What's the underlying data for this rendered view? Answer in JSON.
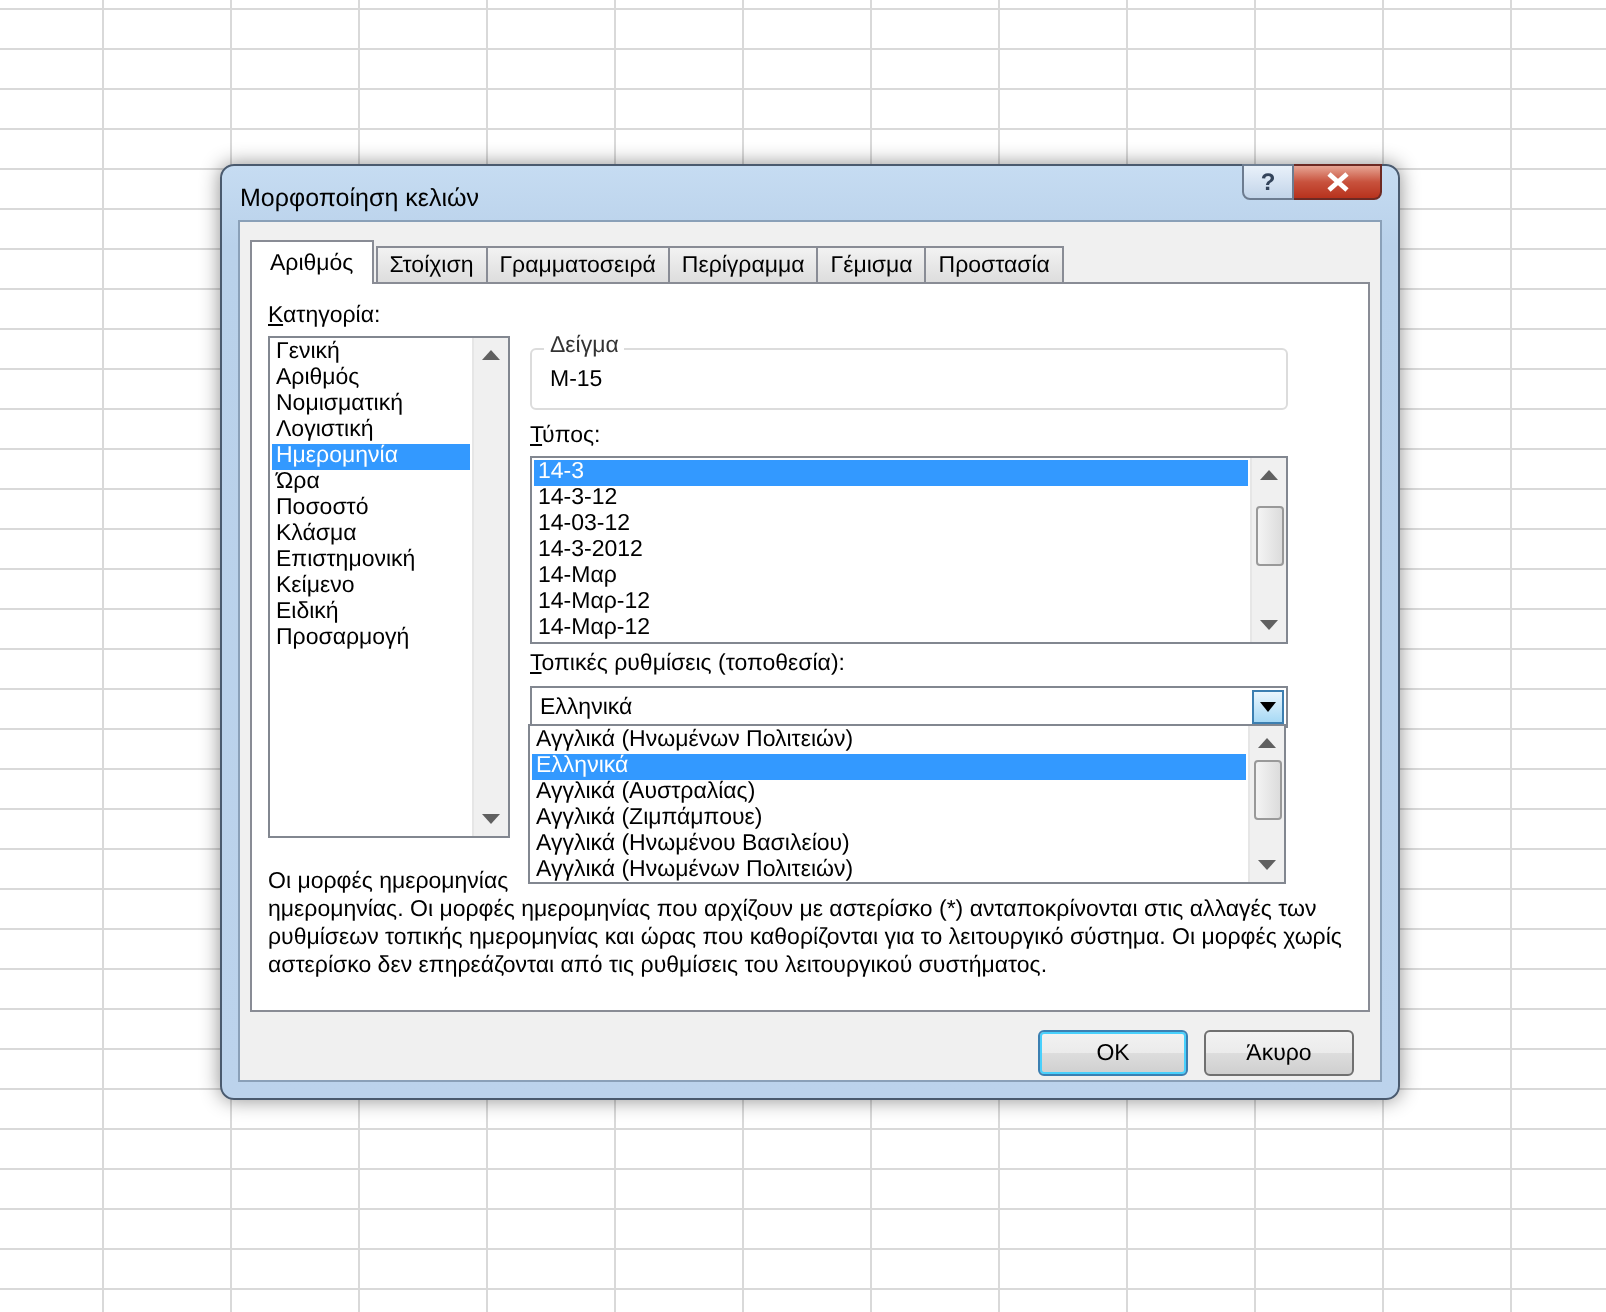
{
  "window": {
    "title": "Μορφοποίηση κελιών",
    "help": "?"
  },
  "tabs": [
    {
      "label": "Αριθμός",
      "selected": true
    },
    {
      "label": "Στοίχιση",
      "selected": false
    },
    {
      "label": "Γραμματοσειρά",
      "selected": false
    },
    {
      "label": "Περίγραμμα",
      "selected": false
    },
    {
      "label": "Γέμισμα",
      "selected": false
    },
    {
      "label": "Προστασία",
      "selected": false
    }
  ],
  "category": {
    "label": "Κατηγορία:",
    "items": [
      {
        "label": "Γενική",
        "selected": false
      },
      {
        "label": "Αριθμός",
        "selected": false
      },
      {
        "label": "Νομισματική",
        "selected": false
      },
      {
        "label": "Λογιστική",
        "selected": false
      },
      {
        "label": "Ημερομηνία",
        "selected": true
      },
      {
        "label": "Ώρα",
        "selected": false
      },
      {
        "label": "Ποσοστό",
        "selected": false
      },
      {
        "label": "Κλάσμα",
        "selected": false
      },
      {
        "label": "Επιστημονική",
        "selected": false
      },
      {
        "label": "Κείμενο",
        "selected": false
      },
      {
        "label": "Ειδική",
        "selected": false
      },
      {
        "label": "Προσαρμογή",
        "selected": false
      }
    ]
  },
  "sample": {
    "label": "Δείγμα",
    "value": "Μ-15"
  },
  "type": {
    "label": "Τύπος:",
    "items": [
      {
        "label": "14-3",
        "selected": true
      },
      {
        "label": "14-3-12",
        "selected": false
      },
      {
        "label": "14-03-12",
        "selected": false
      },
      {
        "label": "14-3-2012",
        "selected": false
      },
      {
        "label": "14-Μαρ",
        "selected": false
      },
      {
        "label": "14-Μαρ-12",
        "selected": false
      },
      {
        "label": "14-Μαρ-12",
        "selected": false
      }
    ]
  },
  "locale": {
    "label": "Τοπικές ρυθμίσεις (τοποθεσία):",
    "value": "Ελληνικά",
    "expanded": true,
    "options": [
      {
        "label": "Αγγλικά (Ηνωμένων Πολιτειών)",
        "selected": false
      },
      {
        "label": "Ελληνικά",
        "selected": true
      },
      {
        "label": "Αγγλικά (Αυστραλίας)",
        "selected": false
      },
      {
        "label": "Αγγλικά (Ζιμπάμπουε)",
        "selected": false
      },
      {
        "label": "Αγγλικά (Ηνωμένου Βασιλείου)",
        "selected": false
      },
      {
        "label": "Αγγλικά (Ηνωμένων Πολιτειών)",
        "selected": false
      }
    ]
  },
  "description": {
    "visible_start": "Οι μορφές ημερομηνίας",
    "text": "ημερομηνίας. Οι μορφές ημερομηνίας που αρχίζουν με αστερίσκο (*) ανταποκρίνονται στις αλλαγές των ρυθμίσεων τοπικής ημερομηνίας και ώρας που καθορίζονται για το λειτουργικό σύστημα. Οι μορφές χωρίς αστερίσκο δεν επηρεάζονται από τις ρυθμίσεις του λειτουργικού συστήματος."
  },
  "buttons": [
    {
      "label": "OK",
      "kind": "default"
    },
    {
      "label": "Άκυρο",
      "kind": "normal"
    }
  ]
}
